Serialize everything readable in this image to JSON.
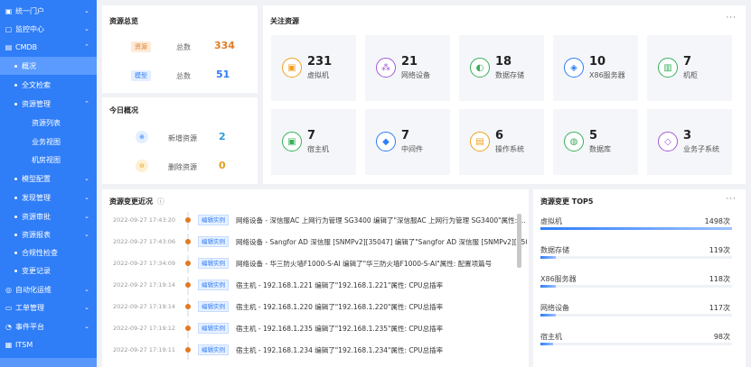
{
  "sidebar": {
    "items": [
      {
        "label": "统一门户",
        "icon": "portal-icon"
      },
      {
        "label": "监控中心",
        "icon": "monitor-icon"
      },
      {
        "label": "CMDB",
        "icon": "cmdb-icon"
      },
      {
        "label": "概况"
      },
      {
        "label": "全文检索"
      },
      {
        "label": "资源管理"
      },
      {
        "label": "资源列表"
      },
      {
        "label": "业务视图"
      },
      {
        "label": "机房视图"
      },
      {
        "label": "模型配置"
      },
      {
        "label": "发现管理"
      },
      {
        "label": "资源审批"
      },
      {
        "label": "资源报表"
      },
      {
        "label": "合规性检查"
      },
      {
        "label": "变更记录"
      },
      {
        "label": "自动化运维",
        "icon": "automation-icon"
      },
      {
        "label": "工单管理",
        "icon": "ticket-icon"
      },
      {
        "label": "事件平台",
        "icon": "event-icon"
      },
      {
        "label": "ITSM",
        "icon": "itsm-icon"
      }
    ]
  },
  "overview": {
    "title": "资源总览",
    "rows": [
      {
        "tag": "资源",
        "label": "总数",
        "value": "334"
      },
      {
        "tag": "模型",
        "label": "总数",
        "value": "51"
      }
    ]
  },
  "today": {
    "title": "今日概况",
    "rows": [
      {
        "label": "新增资源",
        "value": "2"
      },
      {
        "label": "删除资源",
        "value": "0"
      }
    ]
  },
  "followed": {
    "title": "关注资源",
    "more": "···",
    "tiles": [
      {
        "value": "231",
        "label": "虚拟机",
        "icon": "vm-icon",
        "color": "#f0a020"
      },
      {
        "value": "21",
        "label": "网络设备",
        "icon": "network-device-icon",
        "color": "#a35bd8"
      },
      {
        "value": "18",
        "label": "数据存储",
        "icon": "storage-icon",
        "color": "#38b05a"
      },
      {
        "value": "10",
        "label": "X86服务器",
        "icon": "server-icon",
        "color": "#2f7df7"
      },
      {
        "value": "7",
        "label": "机柜",
        "icon": "cabinet-icon",
        "color": "#38b05a"
      },
      {
        "value": "7",
        "label": "宿主机",
        "icon": "host-icon",
        "color": "#38b05a"
      },
      {
        "value": "7",
        "label": "中间件",
        "icon": "middleware-icon",
        "color": "#2f7df7"
      },
      {
        "value": "6",
        "label": "操作系统",
        "icon": "os-icon",
        "color": "#f0a020"
      },
      {
        "value": "5",
        "label": "数据库",
        "icon": "database-icon",
        "color": "#38b05a"
      },
      {
        "value": "3",
        "label": "业务子系统",
        "icon": "subsystem-icon",
        "color": "#a35bd8"
      }
    ]
  },
  "changes": {
    "title": "资源变更近况",
    "rows": [
      {
        "time": "2022-09-27 17:43:20",
        "tag": "编辑实例",
        "text": "网络设备 - 深信服AC 上网行为管理 SG3400   编辑了\"深信服AC 上网行为管理 SG3400\"属性: ..."
      },
      {
        "time": "2022-09-27 17:43:06",
        "tag": "编辑实例",
        "text": "网络设备 - Sangfor AD 深信服 [SNMPv2][35047]   编辑了\"Sangfor AD 深信服 [SNMPv2][35047..."
      },
      {
        "time": "2022-09-27 17:34:09",
        "tag": "编辑实例",
        "text": "网络设备 - 华三防火墙F1000-S-AI   编辑了\"华三防火墙F1000-S-AI\"属性: 配置项篇号"
      },
      {
        "time": "2022-09-27 17:19:14",
        "tag": "编辑实例",
        "text": "宿主机 - 192.168.1.221   编辑了\"192.168.1.221\"属性: CPU总插率"
      },
      {
        "time": "2022-09-27 17:19:14",
        "tag": "编辑实例",
        "text": "宿主机 - 192.168.1.220   编辑了\"192.168.1.220\"属性: CPU总插率"
      },
      {
        "time": "2022-09-27 17:19:12",
        "tag": "编辑实例",
        "text": "宿主机 - 192.168.1.235   编辑了\"192.168.1.235\"属性: CPU总插率"
      },
      {
        "time": "2022-09-27 17:19:11",
        "tag": "编辑实例",
        "text": "宿主机 - 192.168.1.234   编辑了\"192.168.1.234\"属性: CPU总插率"
      }
    ]
  },
  "top5": {
    "title": "资源变更 TOP5",
    "more": "···",
    "rows": [
      {
        "name": "虚拟机",
        "value": "1498次",
        "fraction": 1.0
      },
      {
        "name": "数据存储",
        "value": "119次",
        "fraction": 0.08
      },
      {
        "name": "X86服务器",
        "value": "118次",
        "fraction": 0.08
      },
      {
        "name": "网络设备",
        "value": "117次",
        "fraction": 0.078
      },
      {
        "name": "宿主机",
        "value": "98次",
        "fraction": 0.065
      }
    ]
  }
}
